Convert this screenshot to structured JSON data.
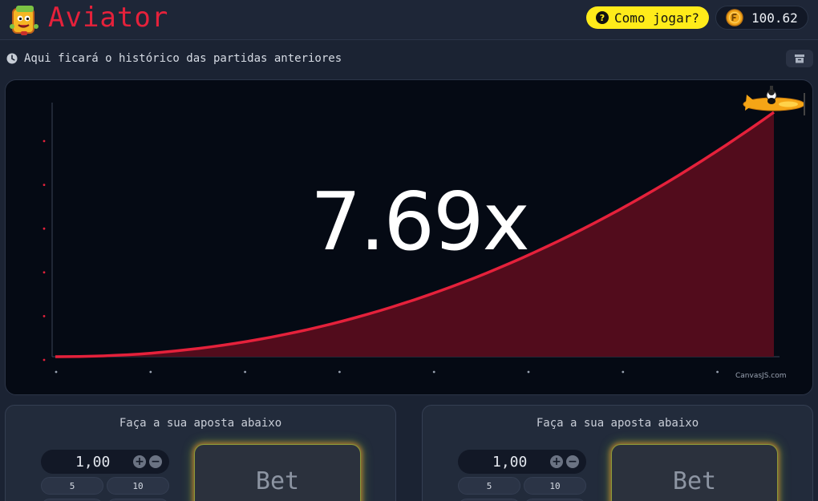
{
  "header": {
    "title": "Aviator",
    "how_to_play_label": "Como jogar?",
    "balance": "100.62",
    "logo_icon": "mascot-logo-icon",
    "coin_icon": "coin-icon"
  },
  "history": {
    "text": "Aqui ficará o histórico das partidas anteriores",
    "icon": "clock-icon",
    "button_icon": "archive-icon"
  },
  "game": {
    "multiplier": "7.69x",
    "credit": "CanvasJS.com",
    "curve_color": "#e5213b",
    "fill_color": "#520c1c",
    "plane_icon": "airplane-icon"
  },
  "bet_panels": [
    {
      "title": "Faça a sua aposta abaixo",
      "amount": "1,00",
      "quick_amounts": [
        "5",
        "10",
        "",
        ""
      ],
      "bet_label": "Bet"
    },
    {
      "title": "Faça a sua aposta abaixo",
      "amount": "1,00",
      "quick_amounts": [
        "5",
        "10",
        "",
        ""
      ],
      "bet_label": "Bet"
    }
  ],
  "colors": {
    "background": "#1b2333",
    "accent": "#e5213b",
    "button_yellow": "#ffeb1a"
  }
}
